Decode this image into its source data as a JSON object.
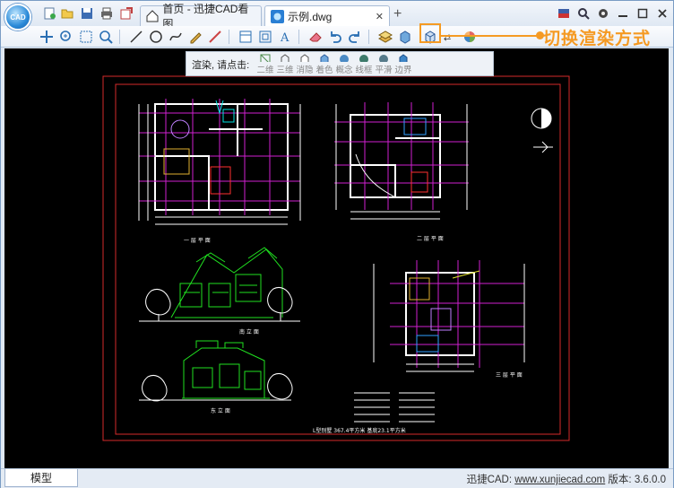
{
  "window": {
    "app_logo_text": "CAD",
    "tabs": [
      {
        "label": "首页 - 迅捷CAD看图"
      },
      {
        "label": "示例.dwg"
      }
    ],
    "new_tab_symbol": "+",
    "tab_close_symbol": "✕"
  },
  "callout": {
    "text": "切换渲染方式",
    "color": "#f59a23"
  },
  "render_popup": {
    "label": "渲染, 请点击:",
    "modes": [
      {
        "label": "二维",
        "icon": "2d-wireframe-icon"
      },
      {
        "label": "三维",
        "icon": "3d-wireframe-icon"
      },
      {
        "label": "消隐",
        "icon": "hidden-icon"
      },
      {
        "label": "着色",
        "icon": "shaded-icon"
      },
      {
        "label": "概念",
        "icon": "conceptual-icon"
      },
      {
        "label": "线框",
        "icon": "wireframe-icon"
      },
      {
        "label": "平滑",
        "icon": "smooth-icon"
      },
      {
        "label": "边界",
        "icon": "edges-icon"
      }
    ]
  },
  "drawing": {
    "labels": {
      "floor1_title": "一 层 平 面",
      "floor2_title": "二 层 平 面",
      "floor3_title": "三 层 平 面",
      "front_elev": "南 立 面",
      "side_elev": "东 立 面",
      "area_note": "L型别墅   367.4平方米  基底23.1平方米"
    }
  },
  "status": {
    "model_tab": "模型",
    "prefix": "迅捷CAD: ",
    "url": "www.xunjiecad.com",
    "version": " 版本: 3.6.0.0"
  }
}
